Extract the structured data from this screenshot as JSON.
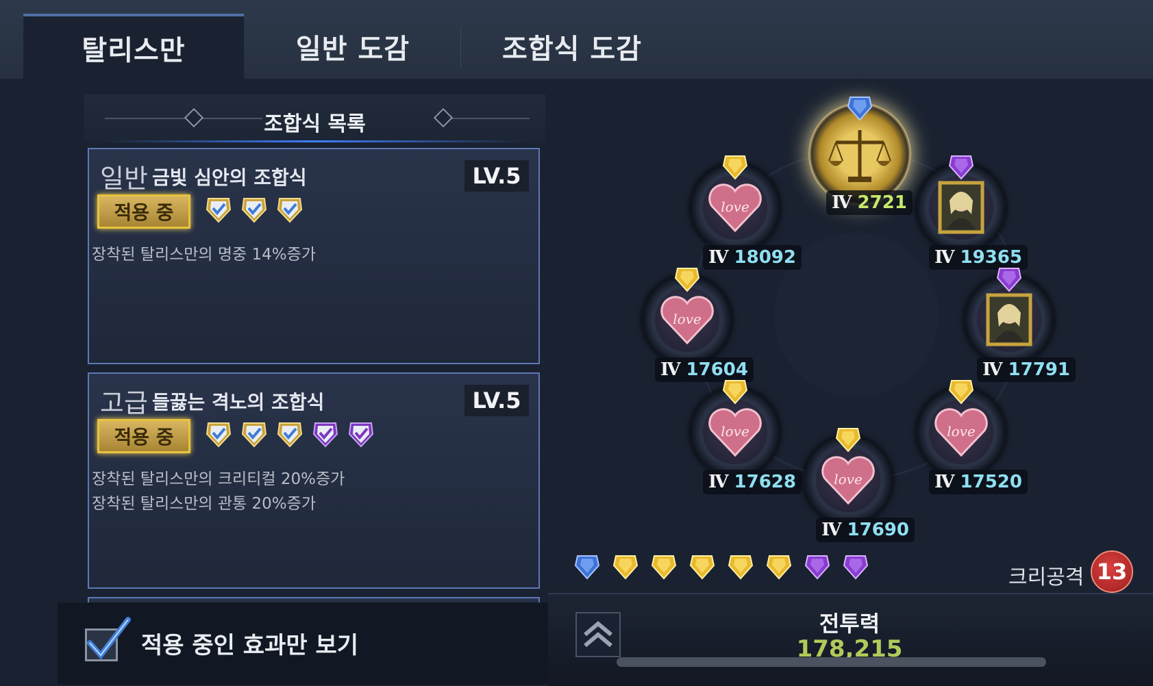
{
  "tabs": [
    {
      "label": "탈리스만",
      "active": true
    },
    {
      "label": "일반 도감",
      "active": false
    },
    {
      "label": "조합식 도감",
      "active": false
    }
  ],
  "list": {
    "header": "조합식 목록",
    "cards": [
      {
        "grade": "일반",
        "name": "금빛 심안의 조합식",
        "level": "LV.5",
        "badge": "적용 중",
        "gems": [
          "gold-check-gem-icon",
          "gold-check-gem-icon",
          "gold-check-gem-icon"
        ],
        "effects": [
          "장착된 탈리스만의 명중 14%증가"
        ]
      },
      {
        "grade": "고급",
        "name": "들끓는 격노의 조합식",
        "level": "LV.5",
        "badge": "적용 중",
        "gems": [
          "gold-check-gem-icon",
          "gold-check-gem-icon",
          "gold-check-gem-icon",
          "purple-check-gem-icon",
          "purple-check-gem-icon"
        ],
        "effects": [
          "장착된 탈리스만의 크리티컬 20%증가",
          "장착된 탈리스만의 관통 20%증가"
        ]
      }
    ]
  },
  "filter": {
    "label": "적용 중인 효과만 보기",
    "checked": true
  },
  "network": {
    "center": {
      "tier": "Ⅳ",
      "value": "2721",
      "gem": "blue",
      "icon": "scales-icon"
    },
    "nodes": [
      {
        "tier": "Ⅳ",
        "value": "18092",
        "gem": "gold",
        "icon": "love-heart-icon"
      },
      {
        "tier": "Ⅳ",
        "value": "19365",
        "gem": "purple",
        "icon": "portrait-frame-icon"
      },
      {
        "tier": "Ⅳ",
        "value": "17604",
        "gem": "gold",
        "icon": "love-heart-icon"
      },
      {
        "tier": "Ⅳ",
        "value": "17791",
        "gem": "purple",
        "icon": "portrait-frame-icon"
      },
      {
        "tier": "Ⅳ",
        "value": "17628",
        "gem": "gold",
        "icon": "love-heart-icon"
      },
      {
        "tier": "Ⅳ",
        "value": "17520",
        "gem": "gold",
        "icon": "love-heart-icon"
      },
      {
        "tier": "Ⅳ",
        "value": "17690",
        "gem": "gold",
        "icon": "love-heart-icon"
      }
    ]
  },
  "gem_row": [
    "blue",
    "gold",
    "gold",
    "gold",
    "gold",
    "gold",
    "purple",
    "purple"
  ],
  "crit": {
    "label": "크리공격",
    "count": "13"
  },
  "power": {
    "title": "전투력",
    "value": "178,215"
  },
  "colors": {
    "gold": "#e9b92b",
    "blue": "#3f72d8",
    "purple": "#8a3bd0",
    "accent": "#5e79b7"
  }
}
